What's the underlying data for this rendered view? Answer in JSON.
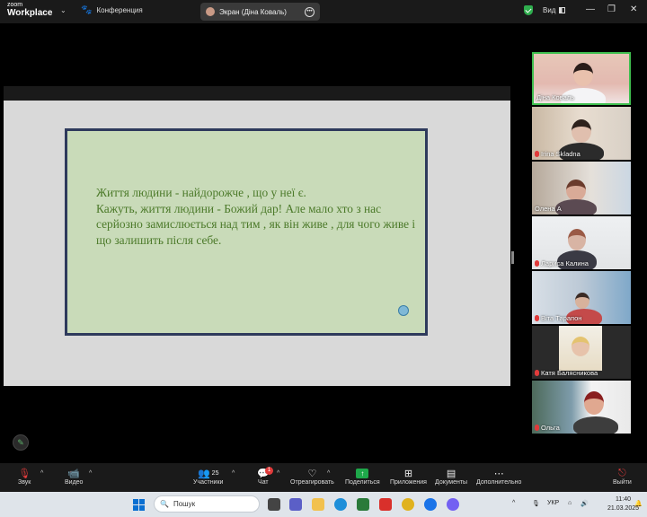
{
  "titlebar": {
    "logo_top": "zoom",
    "logo_bottom": "Workplace",
    "conference_label": "Конференция",
    "screen_pill_label": "Экран (Діна Коваль)",
    "view_label": "Вид",
    "minimize": "—",
    "maximize": "❐",
    "close": "✕"
  },
  "slide": {
    "text_line1": "Життя людини - найдорожче , що у неї є.",
    "text_line2": " Кажуть, життя людини - Божий дар! Але мало хто з нас серйозно замислюється над тим , як він живе , для чого живе і що залишить після себе.",
    "text_color": "#4c7a2a",
    "background_color": "#c9dbb9",
    "border_color": "#2e3a5c"
  },
  "participants": [
    {
      "name": "Діна Коваль",
      "muted": false,
      "active": true
    },
    {
      "name": "Irina Skladna",
      "muted": true,
      "active": false
    },
    {
      "name": "Олена А",
      "muted": false,
      "active": false
    },
    {
      "name": "Лариса Калина",
      "muted": true,
      "active": false
    },
    {
      "name": "Віта Тарапон",
      "muted": true,
      "active": false
    },
    {
      "name": "Катя Балясникова",
      "muted": true,
      "active": false
    },
    {
      "name": "Ольга",
      "muted": true,
      "active": false
    }
  ],
  "toolbar": {
    "audio_label": "Звук",
    "video_label": "Видео",
    "participants_label": "Участники",
    "participants_count": "25",
    "chat_label": "Чат",
    "chat_badge": "1",
    "react_label": "Отреагировать",
    "share_label": "Поделиться",
    "apps_label": "Приложения",
    "docs_label": "Документы",
    "more_label": "Дополнительно",
    "leave_label": "Выйти"
  },
  "taskbar": {
    "search_placeholder": "Пошук",
    "language": "УКР",
    "time": "11:40",
    "date": "21.03.2025"
  },
  "colors": {
    "accent_green": "#3fbf4f",
    "mic_off_red": "#e03b3b",
    "share_green": "#1ea84a"
  }
}
